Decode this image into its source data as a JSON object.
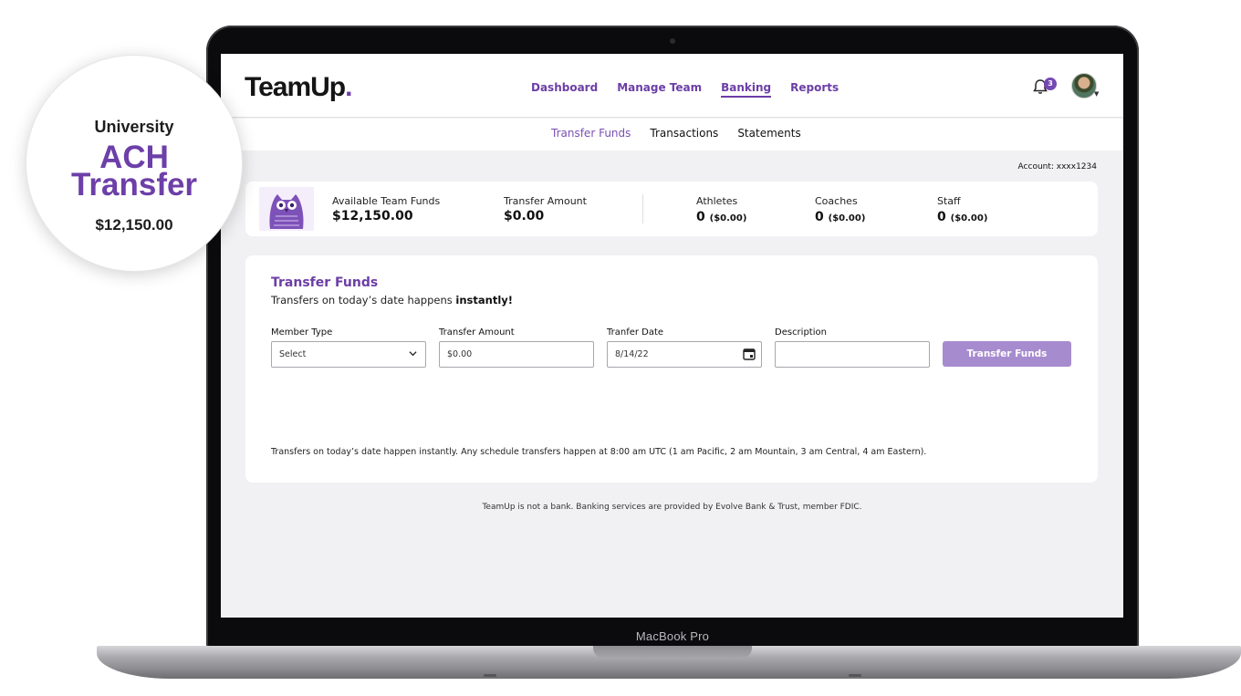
{
  "laptop": {
    "label": "MacBook Pro"
  },
  "header": {
    "logo_main": "TeamUp",
    "logo_dot": ".",
    "nav": [
      {
        "label": "Dashboard",
        "active": false
      },
      {
        "label": "Manage Team",
        "active": false
      },
      {
        "label": "Banking",
        "active": true
      },
      {
        "label": "Reports",
        "active": false
      }
    ],
    "notifications_count": "3"
  },
  "subnav": [
    {
      "label": "Transfer Funds",
      "active": true
    },
    {
      "label": "Transactions",
      "active": false
    },
    {
      "label": "Statements",
      "active": false
    }
  ],
  "account": "Account: xxxx1234",
  "summary": {
    "available_label": "Available Team Funds",
    "available_value": "$12,150.00",
    "transfer_label": "Transfer Amount",
    "transfer_value": "$0.00",
    "athletes_label": "Athletes",
    "athletes_count": "0",
    "athletes_amount": "($0.00)",
    "coaches_label": "Coaches",
    "coaches_count": "0",
    "coaches_amount": "($0.00)",
    "staff_label": "Staff",
    "staff_count": "0",
    "staff_amount": "($0.00)"
  },
  "form": {
    "title": "Transfer Funds",
    "subtitle_prefix": "Transfers on today’s date happens ",
    "subtitle_bold": "instantly!",
    "member_type_label": "Member Type",
    "member_type_value": "Select",
    "amount_label": "Transfer Amount",
    "amount_value": "$0.00",
    "date_label": "Tranfer Date",
    "date_value": "8/14/22",
    "description_label": "Description",
    "description_value": "",
    "submit_label": "Transfer Funds",
    "note": "Transfers on today’s date happen instantly. Any schedule transfers happen at 8:00 am UTC (1 am Pacific, 2 am Mountain, 3 am Central, 4 am Eastern)."
  },
  "footer_note": "TeamUp is not a bank. Banking services are provided by Evolve Bank & Trust, member FDIC.",
  "callout": {
    "line1": "University",
    "line2": "ACH",
    "line3": "Transfer",
    "amount": "$12,150.00"
  },
  "colors": {
    "brand_purple": "#6b3ea6",
    "button_purple": "#a78bcf"
  }
}
